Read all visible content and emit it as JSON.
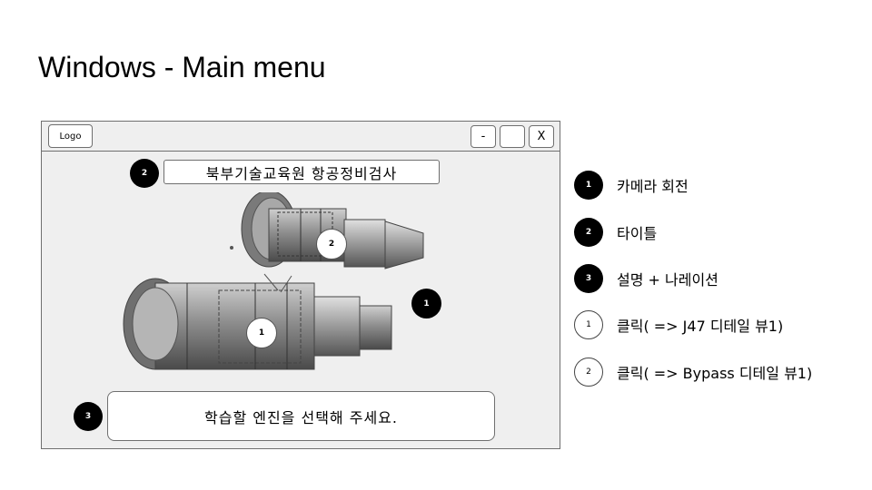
{
  "slide": {
    "title": "Windows - Main menu"
  },
  "window": {
    "logo_label": "Logo",
    "minimize_label": "-",
    "maximize_label": "",
    "close_label": "X",
    "title_text": "북부기술교육원 항공정비검사",
    "narration_text": "학습할 엔진을 선택해 주세요.",
    "badges": {
      "title": "2",
      "narration": "3",
      "camera": "1"
    },
    "hotspots": {
      "j47": "1",
      "bypass": "2"
    }
  },
  "legend": [
    {
      "number": "1",
      "style": "filled",
      "text": "카메라 회전"
    },
    {
      "number": "2",
      "style": "filled",
      "text": "타이틀"
    },
    {
      "number": "3",
      "style": "filled",
      "text": "설명 + 나레이션"
    },
    {
      "number": "1",
      "style": "outline",
      "text": "클릭( => J47 디테일 뷰1)"
    },
    {
      "number": "2",
      "style": "outline",
      "text": "클릭( => Bypass 디테일 뷰1)"
    }
  ],
  "colors": {
    "window_bg": "#efefef",
    "badge": "#000000",
    "border": "#6f6f6f"
  }
}
